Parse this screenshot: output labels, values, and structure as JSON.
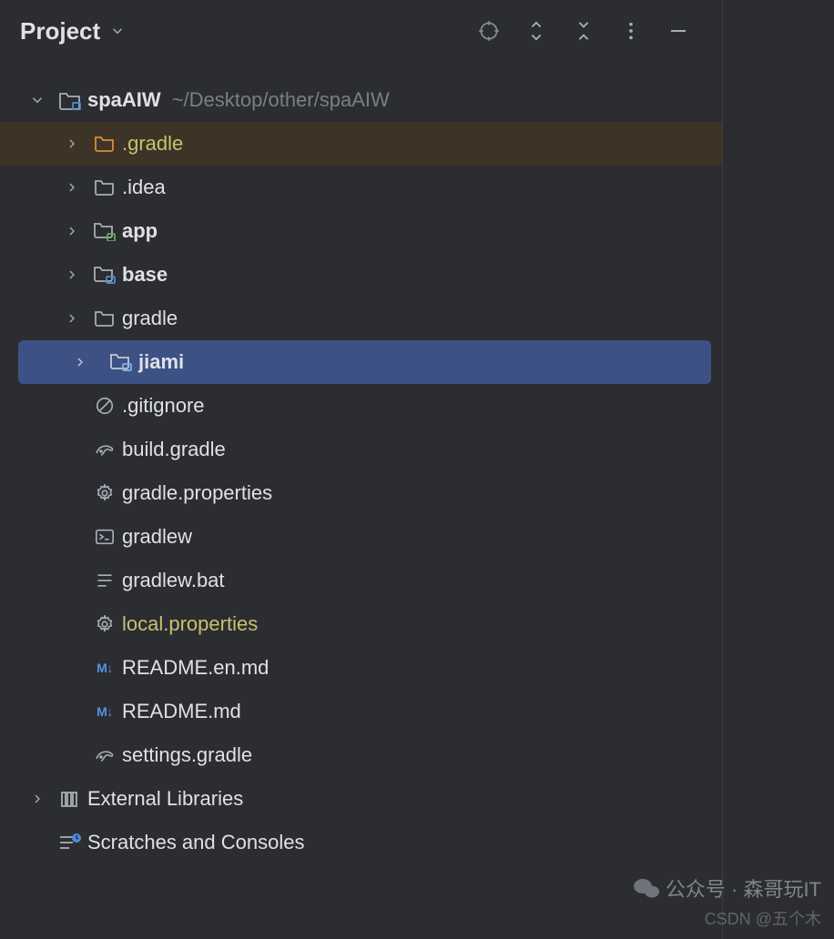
{
  "header": {
    "title": "Project"
  },
  "root": {
    "name": "spaAIW",
    "path": "~/Desktop/other/spaAIW"
  },
  "tree": {
    "gradleDir": ".gradle",
    "idea": ".idea",
    "app": "app",
    "base": "base",
    "gradle": "gradle",
    "jiami": "jiami",
    "gitignore": ".gitignore",
    "buildGradle": "build.gradle",
    "gradleProps": "gradle.properties",
    "gradlew": "gradlew",
    "gradlewBat": "gradlew.bat",
    "localProps": "local.properties",
    "readmeEn": "README.en.md",
    "readme": "README.md",
    "settingsGradle": "settings.gradle"
  },
  "extLibs": "External Libraries",
  "scratches": "Scratches and Consoles",
  "watermark": {
    "wx": "公众号 · 森哥玩IT",
    "csdn": "CSDN @五个木"
  }
}
